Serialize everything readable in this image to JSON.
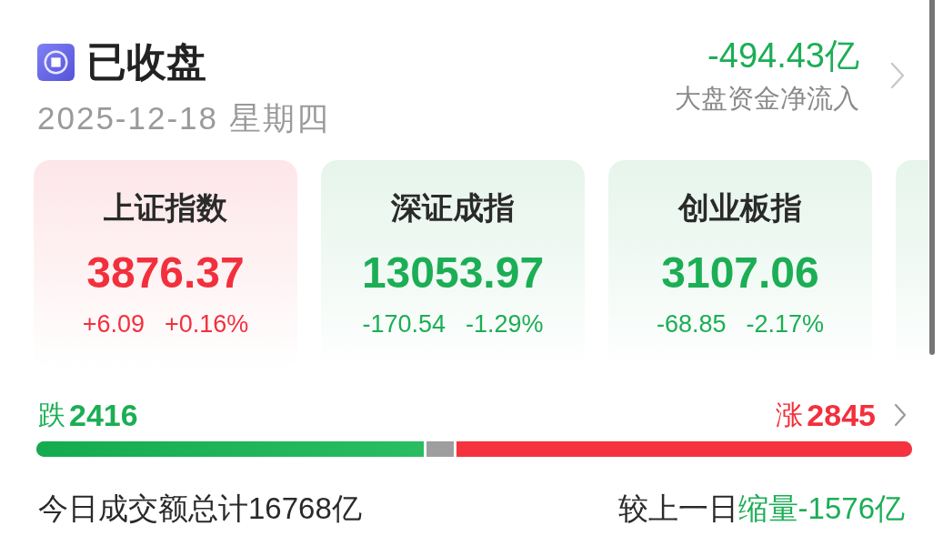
{
  "status": {
    "title": "已收盘",
    "date": "2025-12-18 星期四"
  },
  "net_inflow": {
    "value": "-494.43亿",
    "label": "大盘资金净流入",
    "kind": "down"
  },
  "indices": [
    {
      "name": "上证指数",
      "value": "3876.37",
      "change": "+6.09",
      "change_pct": "+0.16%",
      "kind": "up"
    },
    {
      "name": "深证成指",
      "value": "13053.97",
      "change": "-170.54",
      "change_pct": "-1.29%",
      "kind": "down"
    },
    {
      "name": "创业板指",
      "value": "3107.06",
      "change": "-68.85",
      "change_pct": "-2.17%",
      "kind": "down"
    },
    {
      "kind": "down"
    }
  ],
  "breadth": {
    "falls": {
      "label": "跌",
      "count": "2416",
      "level": 0.442
    },
    "rises": {
      "label": "涨",
      "count": "2845",
      "level": 0.52
    }
  },
  "turnover": {
    "text": "今日成交额总计16768亿",
    "compare_label": "较上一日",
    "change": "缩量-1576亿",
    "kind": "down"
  }
}
